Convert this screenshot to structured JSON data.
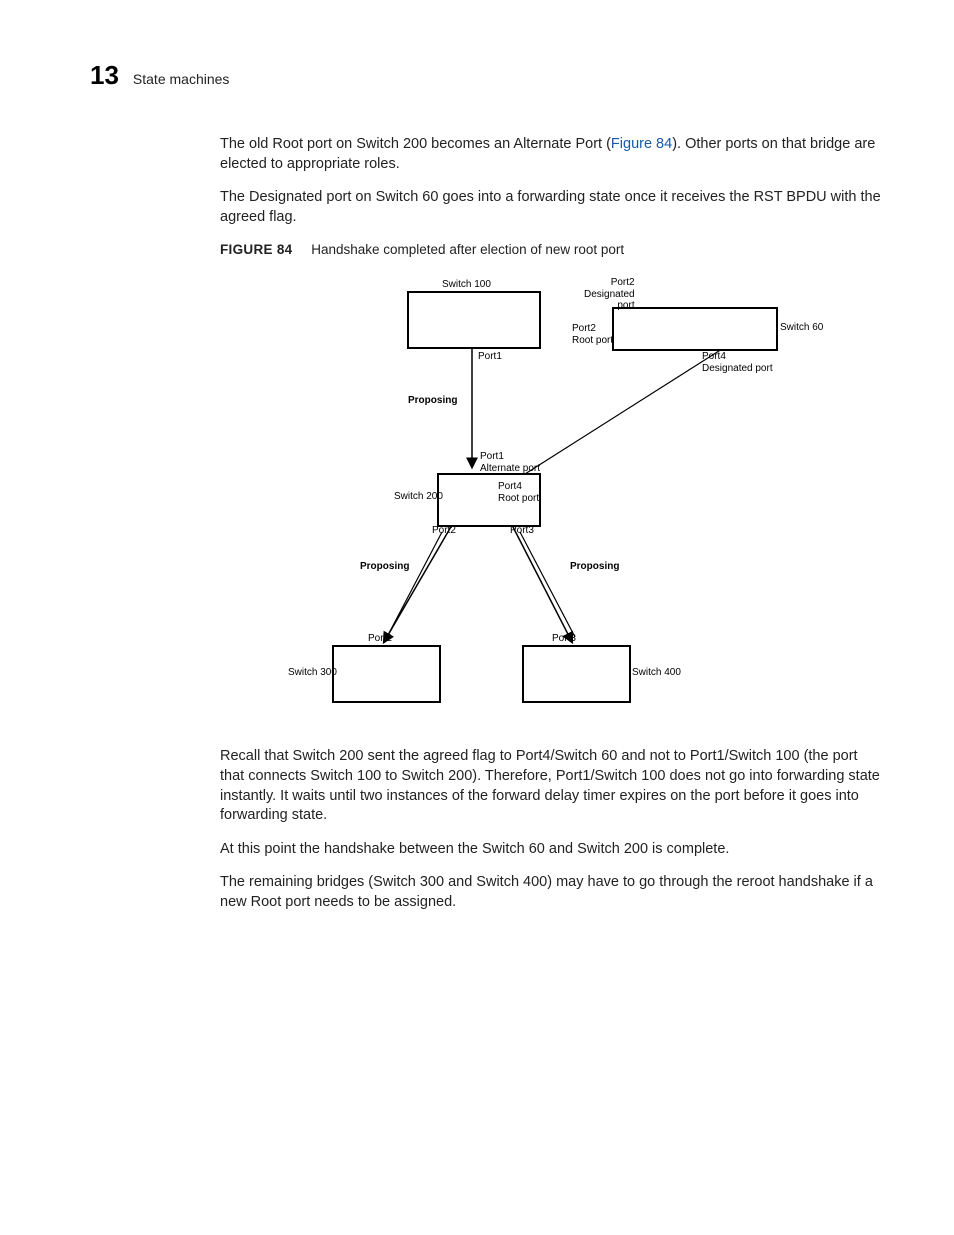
{
  "header": {
    "chapter_number": "13",
    "section_title": "State machines"
  },
  "para1_a": "The old Root port on Switch 200 becomes an Alternate Port (",
  "para1_link": "Figure 84",
  "para1_b": "). Other ports on that bridge are elected to appropriate roles.",
  "para2": "The Designated port on Switch 60 goes into a forwarding state once it receives the RST BPDU with the agreed flag.",
  "figure": {
    "label": "FIGURE 84",
    "caption": "Handshake completed after election of new root port"
  },
  "diagram": {
    "sw100": "Switch 100",
    "sw60": "Switch 60",
    "sw200": "Switch 200",
    "sw300": "Switch 300",
    "sw400": "Switch 400",
    "p2desig": "Port2\nDesignated\nport",
    "p2root": "Port2\nRoot port",
    "p4desig": "Port4\nDesignated port",
    "p1": "Port1",
    "p1alt": "Port1\nAlternate port",
    "p4root": "Port4\nRoot port",
    "p2": "Port2",
    "p3": "Port3",
    "p2b": "Port2",
    "p3b": "Port3",
    "proposing": "Proposing"
  },
  "para3": "Recall that Switch 200 sent the agreed flag to Port4/Switch 60 and not to Port1/Switch 100 (the port that connects Switch 100 to Switch 200). Therefore, Port1/Switch 100 does not go into forwarding state instantly. It waits until two instances of the forward delay timer expires on the port before it goes into forwarding state.",
  "para4": "At this point the handshake between the Switch 60 and Switch 200 is complete.",
  "para5": "The remaining bridges (Switch 300 and Switch 400) may have to go through the reroot handshake if a new Root port needs to be assigned."
}
